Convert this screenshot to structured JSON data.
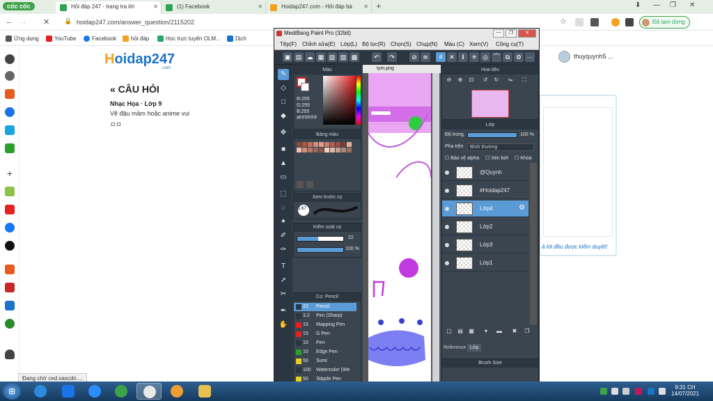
{
  "browser": {
    "brand": "cốc cốc",
    "tabs": [
      {
        "title": "Hỏi đáp 247 - trang tra lời",
        "active": true,
        "color": "#2ea44f"
      },
      {
        "title": "(1) Facebook",
        "active": false,
        "color": "#2ea44f"
      },
      {
        "title": "Hoidap247.com - Hỏi đáp bà",
        "active": false,
        "color": "#f3a11e"
      }
    ],
    "new_tab": "+",
    "url": "hoidap247.com/answer_question/2115202",
    "signed_in_label": "Đã tạm dừng",
    "bookmarks": [
      {
        "label": "Ứng dụng",
        "color": "#555"
      },
      {
        "label": "YouTube",
        "color": "#e52020"
      },
      {
        "label": "Facebook",
        "color": "#1877f2"
      },
      {
        "label": "hỏi đáp",
        "color": "#f3a11e"
      },
      {
        "label": "Học trực tuyến OLM...",
        "color": "#2a6"
      },
      {
        "label": "Dịch",
        "color": "#1a73c9"
      }
    ]
  },
  "page": {
    "logo_h": "H",
    "logo_rest": "oidap247",
    "logo_sub": ".com",
    "question_title": "« CÂU HỎI",
    "question_meta": "Nhạc Họa · Lớp 9",
    "question_text": "Vẽ đậu mầm hoặc anime vui",
    "question_extra": "ㅁㅁ",
    "username": "thuyquynh5 ...",
    "answer_note": "ả lời đều được kiểm duyệt!",
    "status_tip": "Đang chờ ced.sascdn...."
  },
  "medibang": {
    "title": "MediBang Paint Pro (32bit)",
    "menu": [
      "Tệp(F)",
      "Chỉnh sửa(E)",
      "Lớp(L)",
      "Bộ lọc(R)",
      "Chọn(S)",
      "Chụp(N)",
      "Màu (C)",
      "Xem(V)",
      "Công cụ(T)"
    ],
    "color_panel": {
      "title": "Màu",
      "hex": "#FFFFFF",
      "r": "R:255",
      "g": "G:255",
      "b": "B:255"
    },
    "palette_title": "Bảng màu",
    "preview_title": "Xem trước cọ",
    "preview_size": "1.67",
    "brush_control_title": "Kiểm soát cọ",
    "brush_size_value": "22",
    "brush_opacity_value": "100 %",
    "brush_list_title": "Cọ: Pencil",
    "brushes": [
      {
        "size": "22",
        "name": "Pencil",
        "color": "#2b3641",
        "selected": true
      },
      {
        "size": "3.2",
        "name": "Pen (Sharp)",
        "color": "#2b3641",
        "selected": false
      },
      {
        "size": "15",
        "name": "Mapping Pen",
        "color": "#e52020",
        "selected": false
      },
      {
        "size": "15",
        "name": "G Pen",
        "color": "#e52020",
        "selected": false
      },
      {
        "size": "10",
        "name": "Pen",
        "color": "#2b3641",
        "selected": false
      },
      {
        "size": "10",
        "name": "Edge Pen",
        "color": "#2aa02a",
        "selected": false
      },
      {
        "size": "50",
        "name": "Sumi",
        "color": "#e8d020",
        "selected": false
      },
      {
        "size": "100",
        "name": "Watercolor (We",
        "color": "#2b3641",
        "selected": false
      },
      {
        "size": "50",
        "name": "Stipple Pen",
        "color": "#e8d020",
        "selected": false
      }
    ],
    "canvas_tab": "tym.png",
    "navigator_title": "Hoa tiêu",
    "layer_panel": {
      "title": "Lớp",
      "opacity_label": "Độ trong",
      "opacity_value": "100 %",
      "blend_label": "Pha trộn",
      "blend_value": "Bình thường",
      "protect_alpha": "Bảo vệ alpha",
      "clipping": "Xén bớt",
      "lock": "Khóa",
      "layers": [
        {
          "name": "@Quynh",
          "selected": false
        },
        {
          "name": "#Hoidap247",
          "selected": false
        },
        {
          "name": "Lớp4",
          "selected": true
        },
        {
          "name": "Lớp2",
          "selected": false
        },
        {
          "name": "Lớp3",
          "selected": false
        },
        {
          "name": "Lớp1",
          "selected": false
        }
      ],
      "tab_reference": "Reference",
      "tab_layer": "Lớp"
    },
    "brush_size_panel_title": "Brush Size"
  },
  "taskbar": {
    "time": "9:31 CH",
    "date": "14/07/2021"
  },
  "icons": {
    "start": "windows-start-icon",
    "lock": "lock-icon",
    "reload": "reload-icon"
  }
}
